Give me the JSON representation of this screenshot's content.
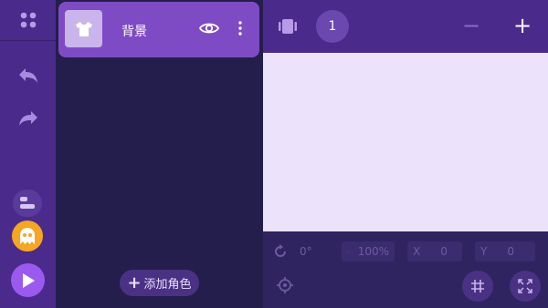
{
  "rail": {
    "menu_icon": "grid-dots-icon",
    "undo_icon": "undo-icon",
    "redo_icon": "redo-icon",
    "tag_icon": "costume-tag-icon",
    "ghost_icon": "ghost-icon",
    "play_icon": "play-icon"
  },
  "sprites": {
    "background": {
      "label": "背景",
      "thumb_icon": "tshirt-icon"
    },
    "add_button": {
      "label": "添加角色"
    }
  },
  "stage": {
    "scene_number": "1",
    "zoom_out": "−",
    "zoom_in": "+"
  },
  "props": {
    "rotation": "0°",
    "scale": "100%",
    "x_label": "X",
    "x_value": "0",
    "y_label": "Y",
    "y_value": "0"
  },
  "colors": {
    "rail": "#4a2a8a",
    "panel": "#231e4b",
    "card": "#7e4bc4",
    "canvas": "#ede2fc",
    "accent_orange": "#f5a623",
    "accent_purple": "#9b59f0"
  }
}
